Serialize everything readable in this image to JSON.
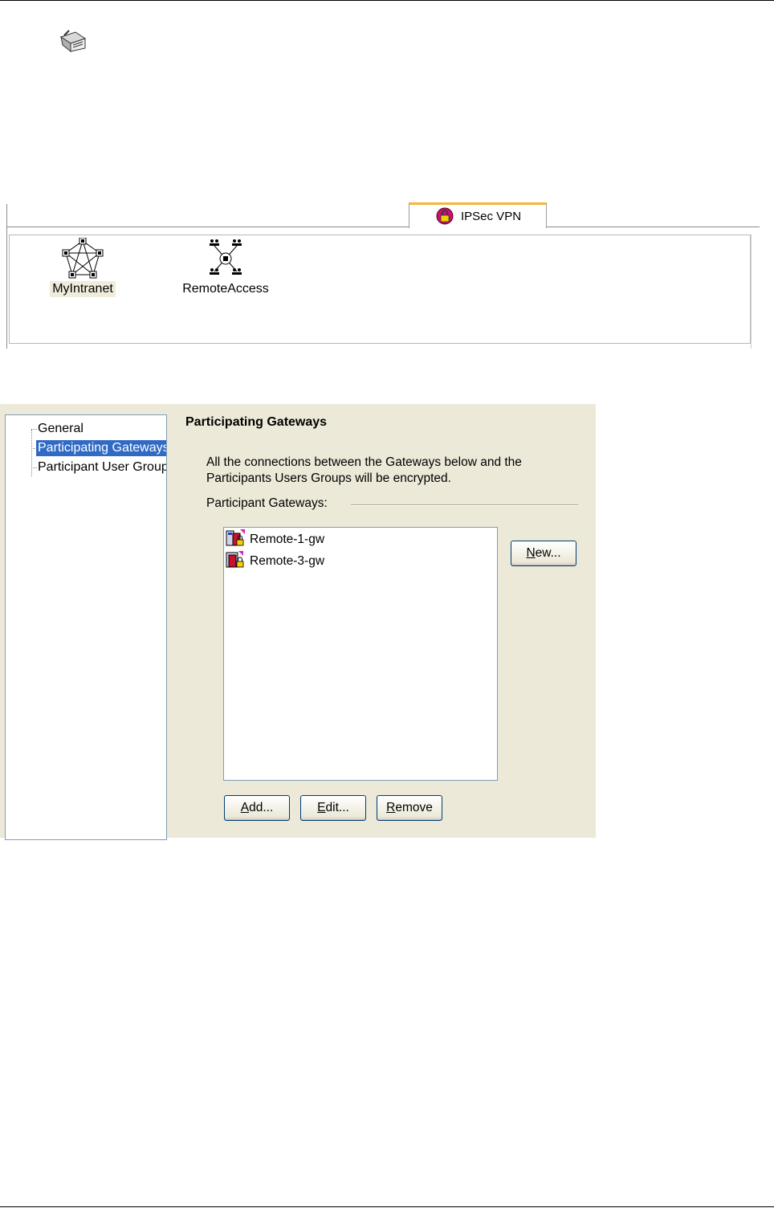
{
  "tab_view": {
    "tab_label": "IPSec VPN",
    "objects": [
      {
        "label": "MyIntranet",
        "icon": "mesh-community-icon",
        "selected": true
      },
      {
        "label": "RemoteAccess",
        "icon": "remote-access-community-icon",
        "selected": false
      }
    ]
  },
  "dialog": {
    "tree": [
      {
        "label": "General",
        "selected": false
      },
      {
        "label": "Participating Gateways",
        "selected": true
      },
      {
        "label": "Participant User Groups",
        "selected": false
      }
    ],
    "section_title": "Participating Gateways",
    "description_line1": "All the connections between the Gateways below and the",
    "description_line2": "Participants Users Groups will be encrypted.",
    "gateways_label": "Participant Gateways:",
    "gateways": [
      {
        "name": "Remote-1-gw",
        "icon": "gateway-cluster-icon"
      },
      {
        "name": "Remote-3-gw",
        "icon": "gateway-icon"
      }
    ],
    "buttons": {
      "new": {
        "mnemonic": "N",
        "rest": "ew..."
      },
      "add": {
        "mnemonic": "A",
        "rest": "dd..."
      },
      "edit": {
        "mnemonic": "E",
        "rest": "dit..."
      },
      "remove": {
        "mnemonic": "R",
        "rest": "emove"
      }
    }
  },
  "colors": {
    "dialog_bg": "#ece9d8",
    "selection": "#316ac5",
    "tab_accent": "#f5b53a"
  }
}
